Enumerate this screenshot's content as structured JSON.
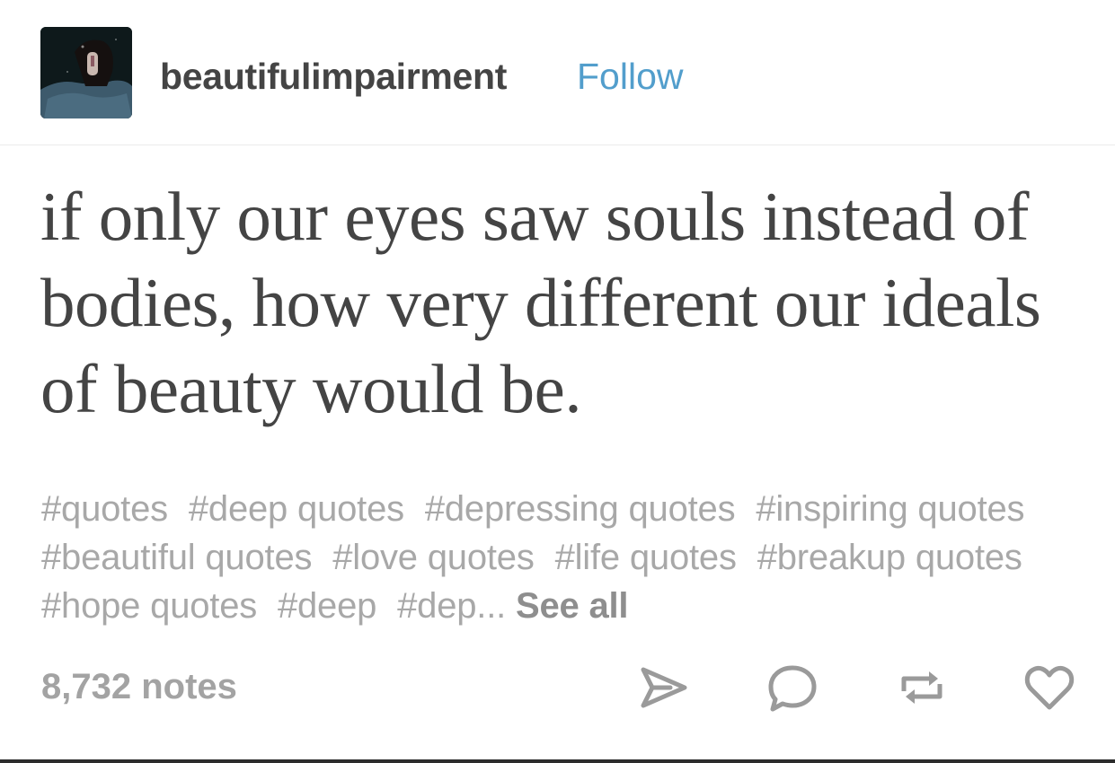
{
  "post": {
    "username": "beautifulimpairment",
    "follow_label": "Follow",
    "quote": "if only our eyes saw souls instead of bodies, how very different our ideals of beauty would be.",
    "tags": [
      "#quotes",
      "#deep quotes",
      "#depressing quotes",
      "#inspiring quotes",
      "#beautiful quotes",
      "#love quotes",
      "#life quotes",
      "#breakup quotes",
      "#hope quotes",
      "#deep",
      "#dep..."
    ],
    "see_all_label": "See all",
    "notes_count": "8,732 notes"
  },
  "actions": [
    {
      "name": "share-icon"
    },
    {
      "name": "reply-icon"
    },
    {
      "name": "reblog-icon"
    },
    {
      "name": "like-icon"
    }
  ],
  "colors": {
    "text": "#444444",
    "follow": "#529ecc",
    "tags": "#a8a8a8",
    "icons": "#9a9a9a"
  }
}
